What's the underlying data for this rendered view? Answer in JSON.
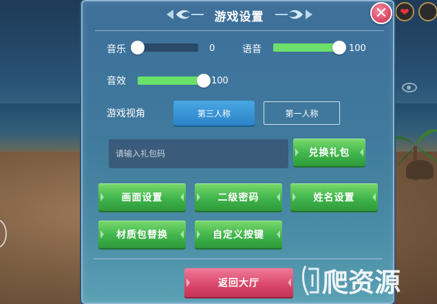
{
  "title": "游戏设置",
  "close_icon": "close-x-icon",
  "audio": {
    "music_label": "音乐",
    "music_value": "0",
    "music_level": 0,
    "voice_label": "语音",
    "voice_value": "100",
    "voice_level": 100,
    "sfx_label": "音效",
    "sfx_value": "100",
    "sfx_level": 100
  },
  "view": {
    "label": "游戏视角",
    "options": [
      "第三人称",
      "第一人称"
    ],
    "selected": "第三人称"
  },
  "gift": {
    "placeholder": "请输入礼包码",
    "redeem_label": "兑换礼包"
  },
  "buttons": {
    "graphics": "画面设置",
    "password": "二级密码",
    "name": "姓名设置",
    "texture": "材质包替换",
    "custom_keys": "自定义按键",
    "back_lobby": "返回大厅"
  },
  "colors": {
    "slider_fill": "#6ce06a",
    "selected_tab": "#2b84c8",
    "green_button": "#3fb54b",
    "red_button": "#d9466a"
  },
  "watermark": "爬爬资源"
}
